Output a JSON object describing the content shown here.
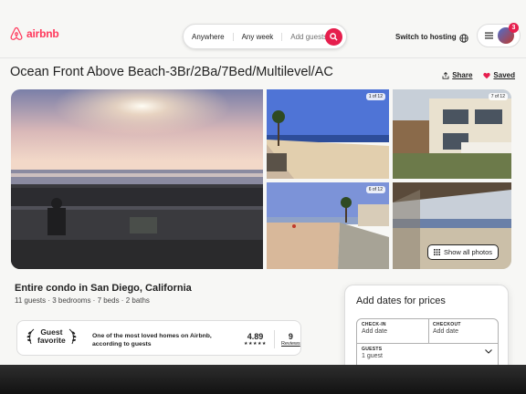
{
  "header": {
    "logo_text": "airbnb",
    "search": {
      "where": "Anywhere",
      "when": "Any week",
      "who": "Add guests"
    },
    "host_link": "Switch to hosting",
    "notification_count": "3"
  },
  "listing": {
    "title": "Ocean Front Above Beach-3Br/2Ba/7Bed/Multilevel/AC",
    "share_label": "Share",
    "save_label": "Saved",
    "photo_counters": [
      "1 of 12",
      "7 of 12",
      "6 of 12"
    ],
    "show_all_photos_label": "Show all photos",
    "subtitle": "Entire condo in San Diego, California",
    "meta": "11 guests · 3 bedrooms · 7 beds · 2 baths"
  },
  "guest_favorite": {
    "label_line1": "Guest",
    "label_line2": "favorite",
    "description": "One of the most loved homes on Airbnb, according to guests",
    "rating": "4.89",
    "stars": "★★★★★",
    "reviews_count": "9",
    "reviews_label": "Reviews"
  },
  "booking": {
    "title": "Add dates for prices",
    "checkin_label": "CHECK-IN",
    "checkin_value": "Add date",
    "checkout_label": "CHECKOUT",
    "checkout_value": "Add date",
    "guests_label": "GUESTS",
    "guests_value": "1 guest"
  },
  "colors": {
    "brand": "#ff385c",
    "search_button": "#e61e4d",
    "text": "#222222"
  }
}
